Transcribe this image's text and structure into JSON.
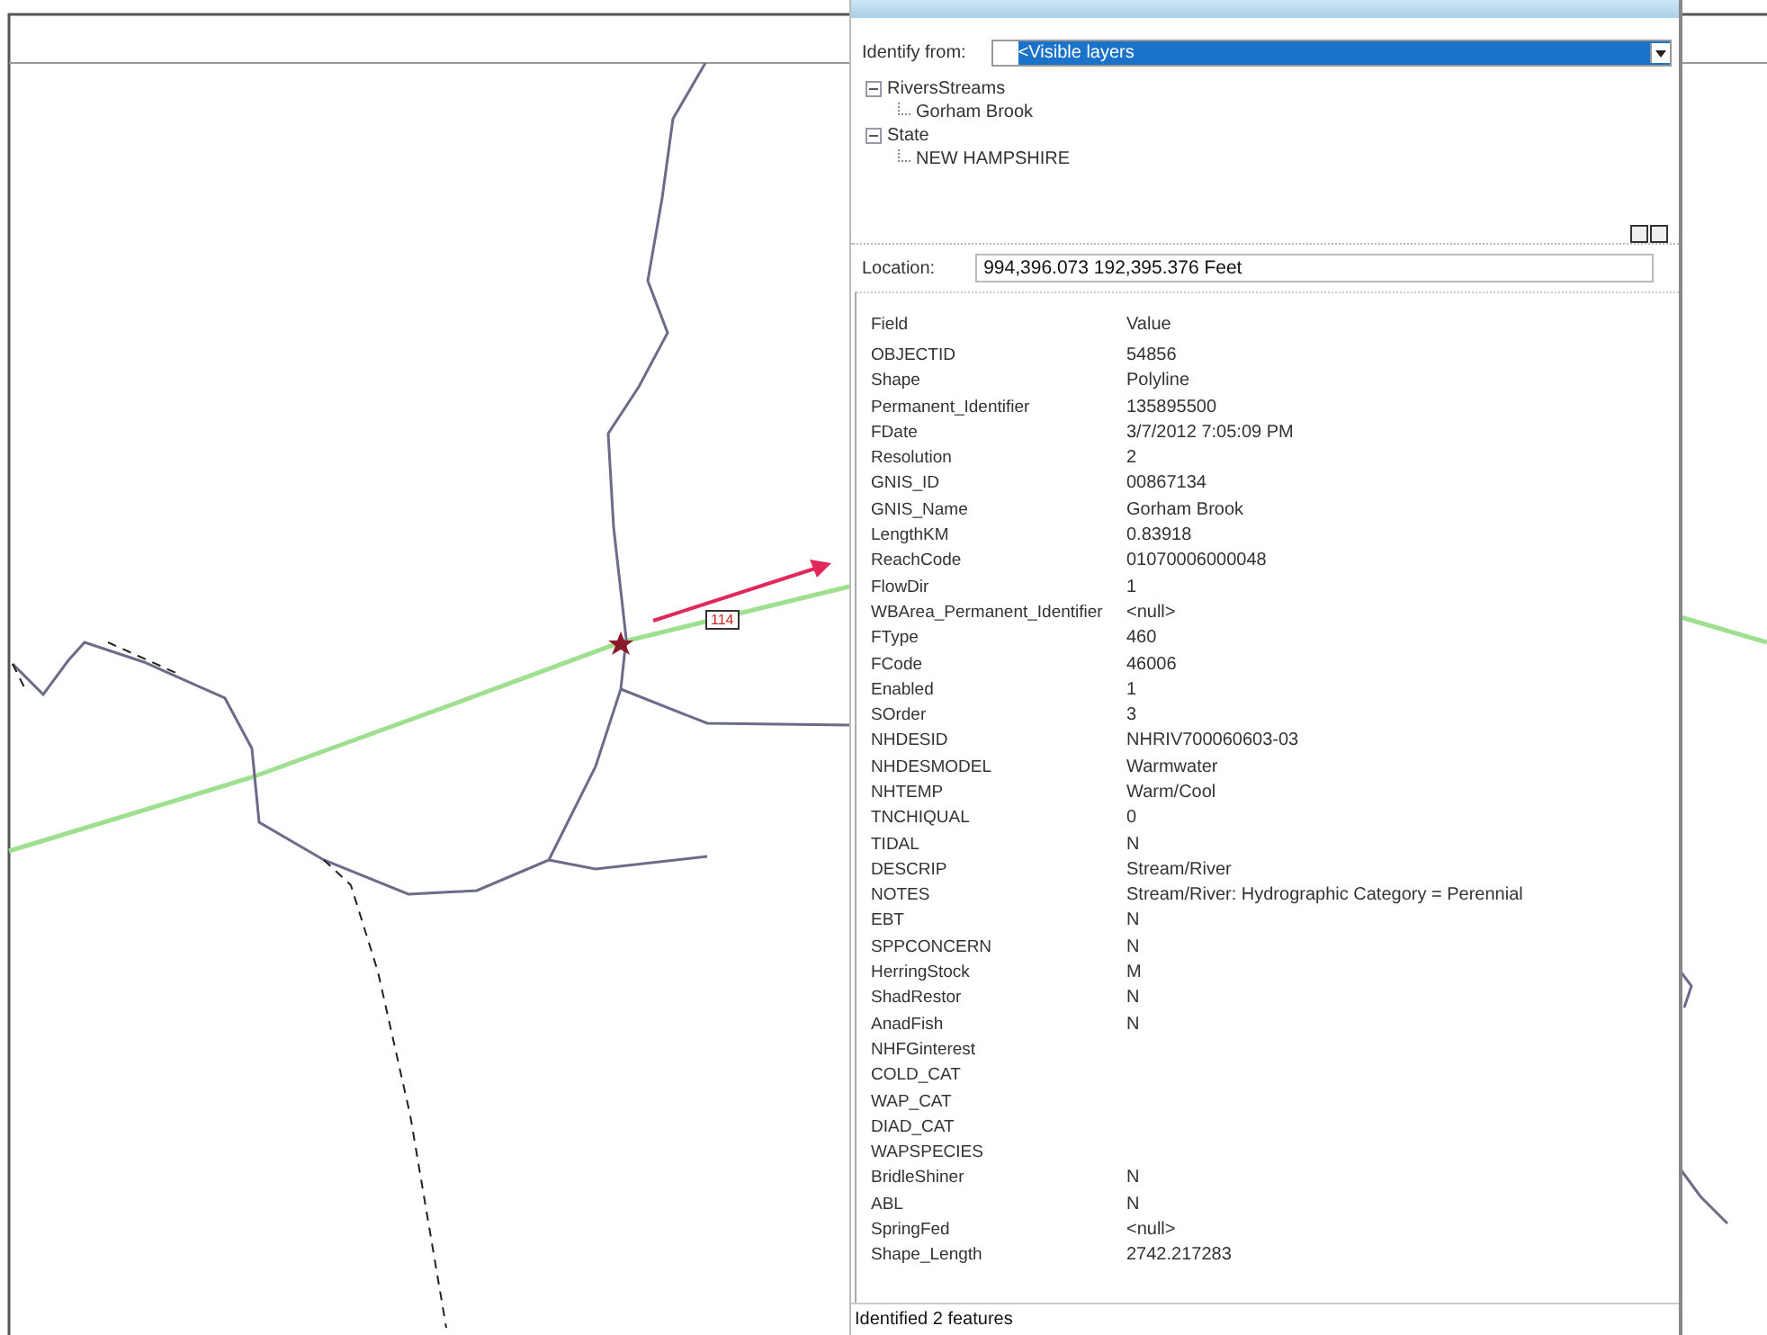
{
  "map": {
    "label": "114"
  },
  "identify": {
    "from_label": "Identify from:",
    "from_value": "<Visible layers",
    "tree": [
      {
        "label": "RiversStreams",
        "expanded": true,
        "children": [
          {
            "label": "Gorham Brook"
          }
        ]
      },
      {
        "label": "State",
        "expanded": true,
        "children": [
          {
            "label": "NEW HAMPSHIRE"
          }
        ]
      }
    ],
    "location_label": "Location:",
    "location_value": "994,396.073  192,395.376 Feet",
    "columns": [
      "Field",
      "Value"
    ],
    "rows": [
      [
        "OBJECTID",
        "54856"
      ],
      [
        "Shape",
        "Polyline"
      ],
      [
        "Permanent_Identifier",
        "135895500"
      ],
      [
        "FDate",
        "3/7/2012 7:05:09 PM"
      ],
      [
        "Resolution",
        "2"
      ],
      [
        "GNIS_ID",
        "00867134"
      ],
      [
        "GNIS_Name",
        "Gorham Brook"
      ],
      [
        "LengthKM",
        "0.83918"
      ],
      [
        "ReachCode",
        "01070006000048"
      ],
      [
        "FlowDir",
        "1"
      ],
      [
        "WBArea_Permanent_Identifier",
        "<null>"
      ],
      [
        "FType",
        "460"
      ],
      [
        "FCode",
        "46006"
      ],
      [
        "Enabled",
        "1"
      ],
      [
        "SOrder",
        "3"
      ],
      [
        "NHDESID",
        "NHRIV700060603-03"
      ],
      [
        "NHDESMODEL",
        "Warmwater"
      ],
      [
        "NHTEMP",
        "Warm/Cool"
      ],
      [
        "TNCHIQUAL",
        "0"
      ],
      [
        "TIDAL",
        "N"
      ],
      [
        "DESCRIP",
        "Stream/River"
      ],
      [
        "NOTES",
        "Stream/River: Hydrographic Category = Perennial"
      ],
      [
        "EBT",
        "N"
      ],
      [
        "SPPCONCERN",
        "N"
      ],
      [
        "HerringStock",
        "M"
      ],
      [
        "ShadRestor",
        "N"
      ],
      [
        "AnadFish",
        "N"
      ],
      [
        "NHFGinterest"
      ],
      [
        "COLD_CAT"
      ],
      [
        "WAP_CAT"
      ],
      [
        "DIAD_CAT"
      ],
      [
        "WAPSPECIES"
      ],
      [
        "BridleShiner",
        "N"
      ],
      [
        "ABL",
        "N"
      ],
      [
        "SpringFed",
        "<null>"
      ],
      [
        "Shape_Length",
        "2742.217283"
      ]
    ],
    "status": "Identified 2 features"
  }
}
